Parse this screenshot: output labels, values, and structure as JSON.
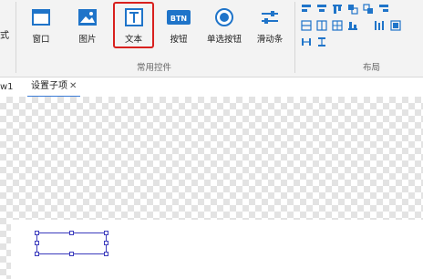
{
  "ribbon": {
    "partial_left_label": "式",
    "common_controls": {
      "group_label": "常用控件",
      "buttons": [
        {
          "label": "窗口",
          "icon": "window-icon"
        },
        {
          "label": "图片",
          "icon": "image-icon"
        },
        {
          "label": "文本",
          "icon": "text-icon",
          "selected": true
        },
        {
          "label": "按钮",
          "icon": "button-icon",
          "icon_text": "BTN"
        },
        {
          "label": "单选按钮",
          "icon": "radio-icon"
        },
        {
          "label": "滑动条",
          "icon": "slider-icon"
        }
      ]
    },
    "layout": {
      "group_label": "布局",
      "icons": [
        "align-left-icon",
        "align-center-icon",
        "align-top-icon",
        "align-front-icon",
        "align-back-icon",
        "align-right-icon",
        "distribute-vertical-icon",
        "distribute-horizontal-icon",
        "grid-icon",
        "align-bottom-icon",
        "distribute-columns-icon",
        "size-icon",
        "spacing-horizontal-icon",
        "spacing-vertical-icon"
      ]
    }
  },
  "tabs": {
    "previous_tab_partial": "w1",
    "active_tab": "设置子项",
    "close_glyph": "✕"
  },
  "colors": {
    "accent_blue": "#3a7bd5",
    "icon_blue": "#1f74c9",
    "selection_red": "#d8201e",
    "selection_box": "#3b3bbd"
  }
}
